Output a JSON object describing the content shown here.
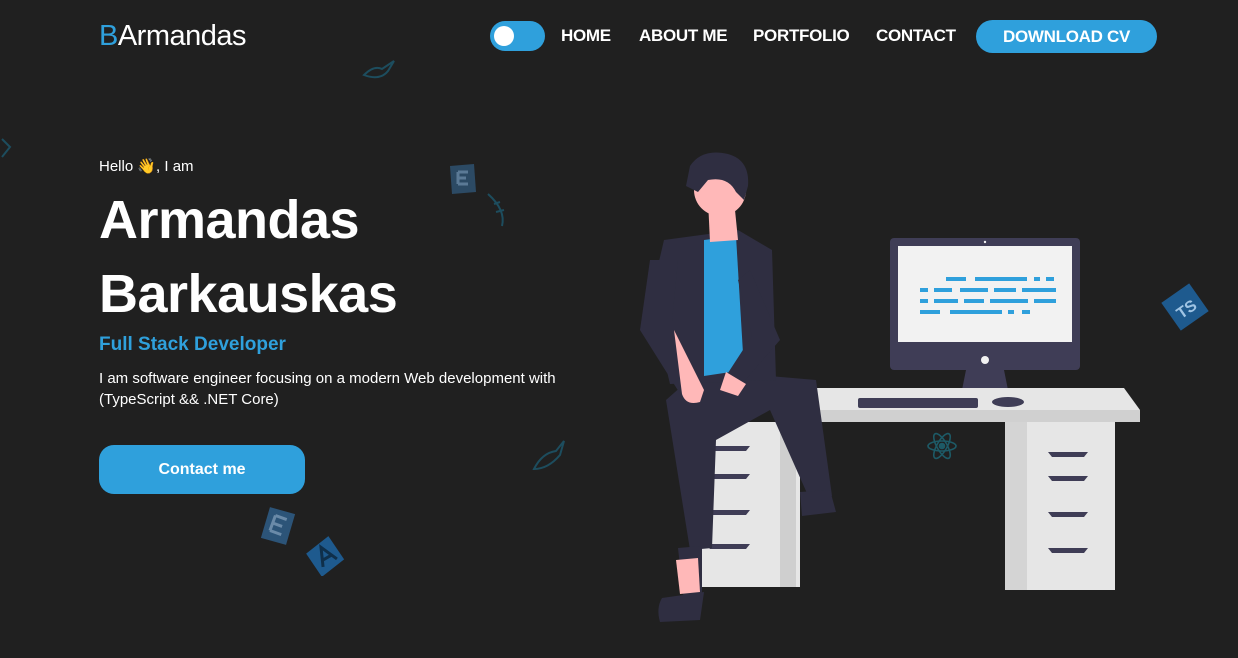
{
  "header": {
    "logo_initial": "B",
    "logo_rest": "Armandas",
    "theme_toggle": "theme-toggle",
    "nav": [
      "HOME",
      "ABOUT ME",
      "PORTFOLIO",
      "CONTACT"
    ],
    "download_cv": "DOWNLOAD CV"
  },
  "hero": {
    "greeting": "Hello 👋, I am",
    "first_name": "Armandas",
    "last_name": "Barkauskas",
    "role": "Full Stack Developer",
    "description": "I am software engineer focusing on a modern Web development with (TypeScript && .NET Core)",
    "contact_button": "Contact me"
  },
  "decorations": {
    "ts_badge": "TS"
  },
  "colors": {
    "accent": "#2fa0dc",
    "background": "#202020",
    "text": "#ffffff"
  }
}
